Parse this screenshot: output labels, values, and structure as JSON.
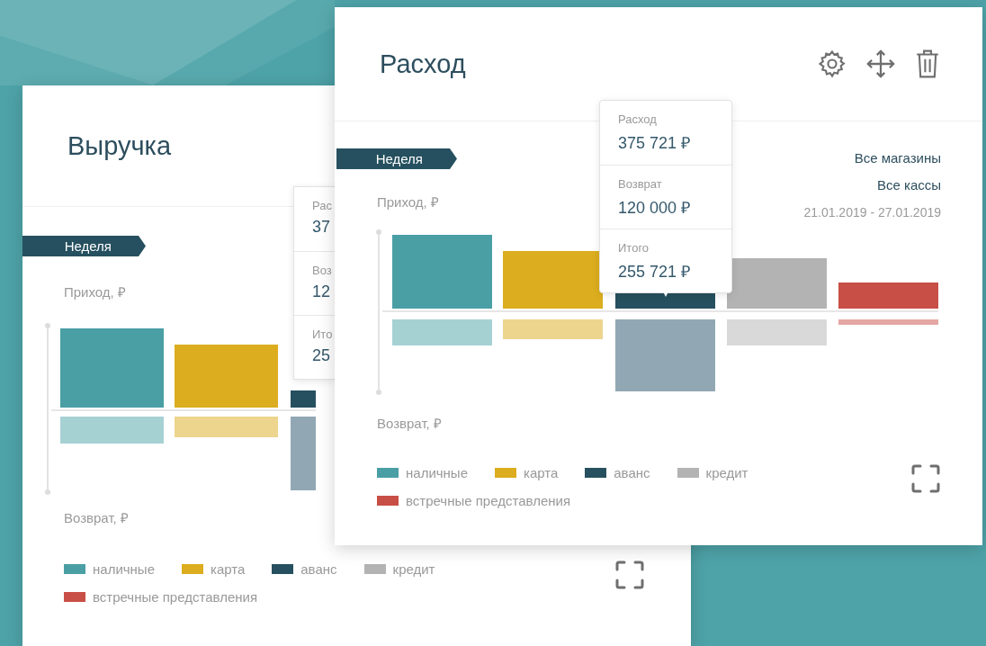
{
  "cards": [
    {
      "title": "Выручка",
      "period_tag": "Неделя",
      "y_label_top": "Приход, ₽",
      "y_label_bottom": "Возврат, ₽",
      "tooltip": [
        {
          "label": "Рас",
          "value": "37"
        },
        {
          "label": "Воз",
          "value": "12"
        },
        {
          "label": "Ито",
          "value": "25"
        }
      ],
      "legend": [
        {
          "label": "наличные",
          "color": "#4a9fa5"
        },
        {
          "label": "карта",
          "color": "#dbad1f"
        },
        {
          "label": "аванс",
          "color": "#26505f"
        },
        {
          "label": "кредит",
          "color": "#b3b3b3"
        },
        {
          "label": "встречные представления",
          "color": "#c84f45"
        }
      ]
    },
    {
      "title": "Расход",
      "period_tag": "Неделя",
      "y_label_top": "Приход, ₽",
      "y_label_bottom": "Возврат, ₽",
      "filters": [
        "Все магазины",
        "Все кассы"
      ],
      "date_range": "21.01.2019 - 27.01.2019",
      "tooltip": [
        {
          "label": "Расход",
          "value": "375 721 ₽"
        },
        {
          "label": "Возврат",
          "value": "120 000 ₽"
        },
        {
          "label": "Итого",
          "value": "255 721 ₽"
        }
      ],
      "legend": [
        {
          "label": "наличные",
          "color": "#4a9fa5"
        },
        {
          "label": "карта",
          "color": "#dbad1f"
        },
        {
          "label": "аванс",
          "color": "#26505f"
        },
        {
          "label": "кредит",
          "color": "#b3b3b3"
        },
        {
          "label": "встречные представления",
          "color": "#c84f45"
        }
      ]
    }
  ]
}
